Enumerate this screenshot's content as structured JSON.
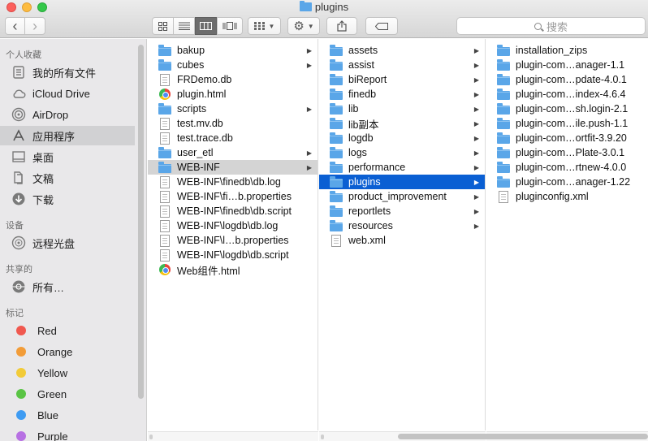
{
  "window": {
    "title": "plugins"
  },
  "toolbar": {
    "back_glyph": "‹",
    "forward_glyph": "›",
    "search_placeholder": "搜索"
  },
  "sidebar": {
    "sections": [
      {
        "label": "个人收藏",
        "items": [
          {
            "label": "我的所有文件",
            "icon": "all-files-icon"
          },
          {
            "label": "iCloud Drive",
            "icon": "cloud-icon"
          },
          {
            "label": "AirDrop",
            "icon": "airdrop-icon"
          },
          {
            "label": "应用程序",
            "icon": "applications-icon",
            "selected": true
          },
          {
            "label": "桌面",
            "icon": "desktop-icon"
          },
          {
            "label": "文稿",
            "icon": "documents-icon"
          },
          {
            "label": "下载",
            "icon": "downloads-icon"
          }
        ]
      },
      {
        "label": "设备",
        "items": [
          {
            "label": "远程光盘",
            "icon": "remote-disc-icon"
          }
        ]
      },
      {
        "label": "共享的",
        "items": [
          {
            "label": "所有…",
            "icon": "network-icon"
          }
        ]
      },
      {
        "label": "标记",
        "items": [
          {
            "label": "Red",
            "color": "#f0584f"
          },
          {
            "label": "Orange",
            "color": "#f29c38"
          },
          {
            "label": "Yellow",
            "color": "#f2cb38"
          },
          {
            "label": "Green",
            "color": "#5ac445"
          },
          {
            "label": "Blue",
            "color": "#3e9bf2"
          },
          {
            "label": "Purple",
            "color": "#b770e3"
          }
        ]
      }
    ]
  },
  "columns": [
    {
      "items": [
        {
          "name": "bakup",
          "type": "folder",
          "arrow": true
        },
        {
          "name": "cubes",
          "type": "folder",
          "arrow": true
        },
        {
          "name": "FRDemo.db",
          "type": "doc"
        },
        {
          "name": "plugin.html",
          "type": "html"
        },
        {
          "name": "scripts",
          "type": "folder",
          "arrow": true
        },
        {
          "name": "test.mv.db",
          "type": "doc"
        },
        {
          "name": "test.trace.db",
          "type": "doc"
        },
        {
          "name": "user_etl",
          "type": "folder",
          "arrow": true
        },
        {
          "name": "WEB-INF",
          "type": "folder",
          "arrow": true,
          "selected": "gray"
        },
        {
          "name": "WEB-INF\\finedb\\db.log",
          "type": "doc"
        },
        {
          "name": "WEB-INF\\fi…b.properties",
          "type": "doc"
        },
        {
          "name": "WEB-INF\\finedb\\db.script",
          "type": "doc"
        },
        {
          "name": "WEB-INF\\logdb\\db.log",
          "type": "doc"
        },
        {
          "name": "WEB-INF\\l…b.properties",
          "type": "doc"
        },
        {
          "name": "WEB-INF\\logdb\\db.script",
          "type": "doc"
        },
        {
          "name": "Web组件.html",
          "type": "html"
        }
      ]
    },
    {
      "items": [
        {
          "name": "assets",
          "type": "folder",
          "arrow": true
        },
        {
          "name": "assist",
          "type": "folder",
          "arrow": true
        },
        {
          "name": "biReport",
          "type": "folder",
          "arrow": true
        },
        {
          "name": "finedb",
          "type": "folder",
          "arrow": true
        },
        {
          "name": "lib",
          "type": "folder",
          "arrow": true
        },
        {
          "name": "lib副本",
          "type": "folder",
          "arrow": true
        },
        {
          "name": "logdb",
          "type": "folder",
          "arrow": true
        },
        {
          "name": "logs",
          "type": "folder",
          "arrow": true
        },
        {
          "name": "performance",
          "type": "folder",
          "arrow": true
        },
        {
          "name": "plugins",
          "type": "folder",
          "arrow": true,
          "selected": "blue"
        },
        {
          "name": "product_improvement",
          "type": "folder",
          "arrow": true
        },
        {
          "name": "reportlets",
          "type": "folder",
          "arrow": true
        },
        {
          "name": "resources",
          "type": "folder",
          "arrow": true
        },
        {
          "name": "web.xml",
          "type": "doc"
        }
      ]
    },
    {
      "items": [
        {
          "name": "installation_zips",
          "type": "folder"
        },
        {
          "name": "plugin-com…anager-1.1",
          "type": "folder"
        },
        {
          "name": "plugin-com…pdate-4.0.1",
          "type": "folder"
        },
        {
          "name": "plugin-com…index-4.6.4",
          "type": "folder"
        },
        {
          "name": "plugin-com…sh.login-2.1",
          "type": "folder"
        },
        {
          "name": "plugin-com…ile.push-1.1",
          "type": "folder"
        },
        {
          "name": "plugin-com…ortfit-3.9.20",
          "type": "folder"
        },
        {
          "name": "plugin-com…Plate-3.0.1",
          "type": "folder"
        },
        {
          "name": "plugin-com…rtnew-4.0.0",
          "type": "folder"
        },
        {
          "name": "plugin-com…anager-1.22",
          "type": "folder"
        },
        {
          "name": "pluginconfig.xml",
          "type": "doc"
        }
      ]
    }
  ]
}
